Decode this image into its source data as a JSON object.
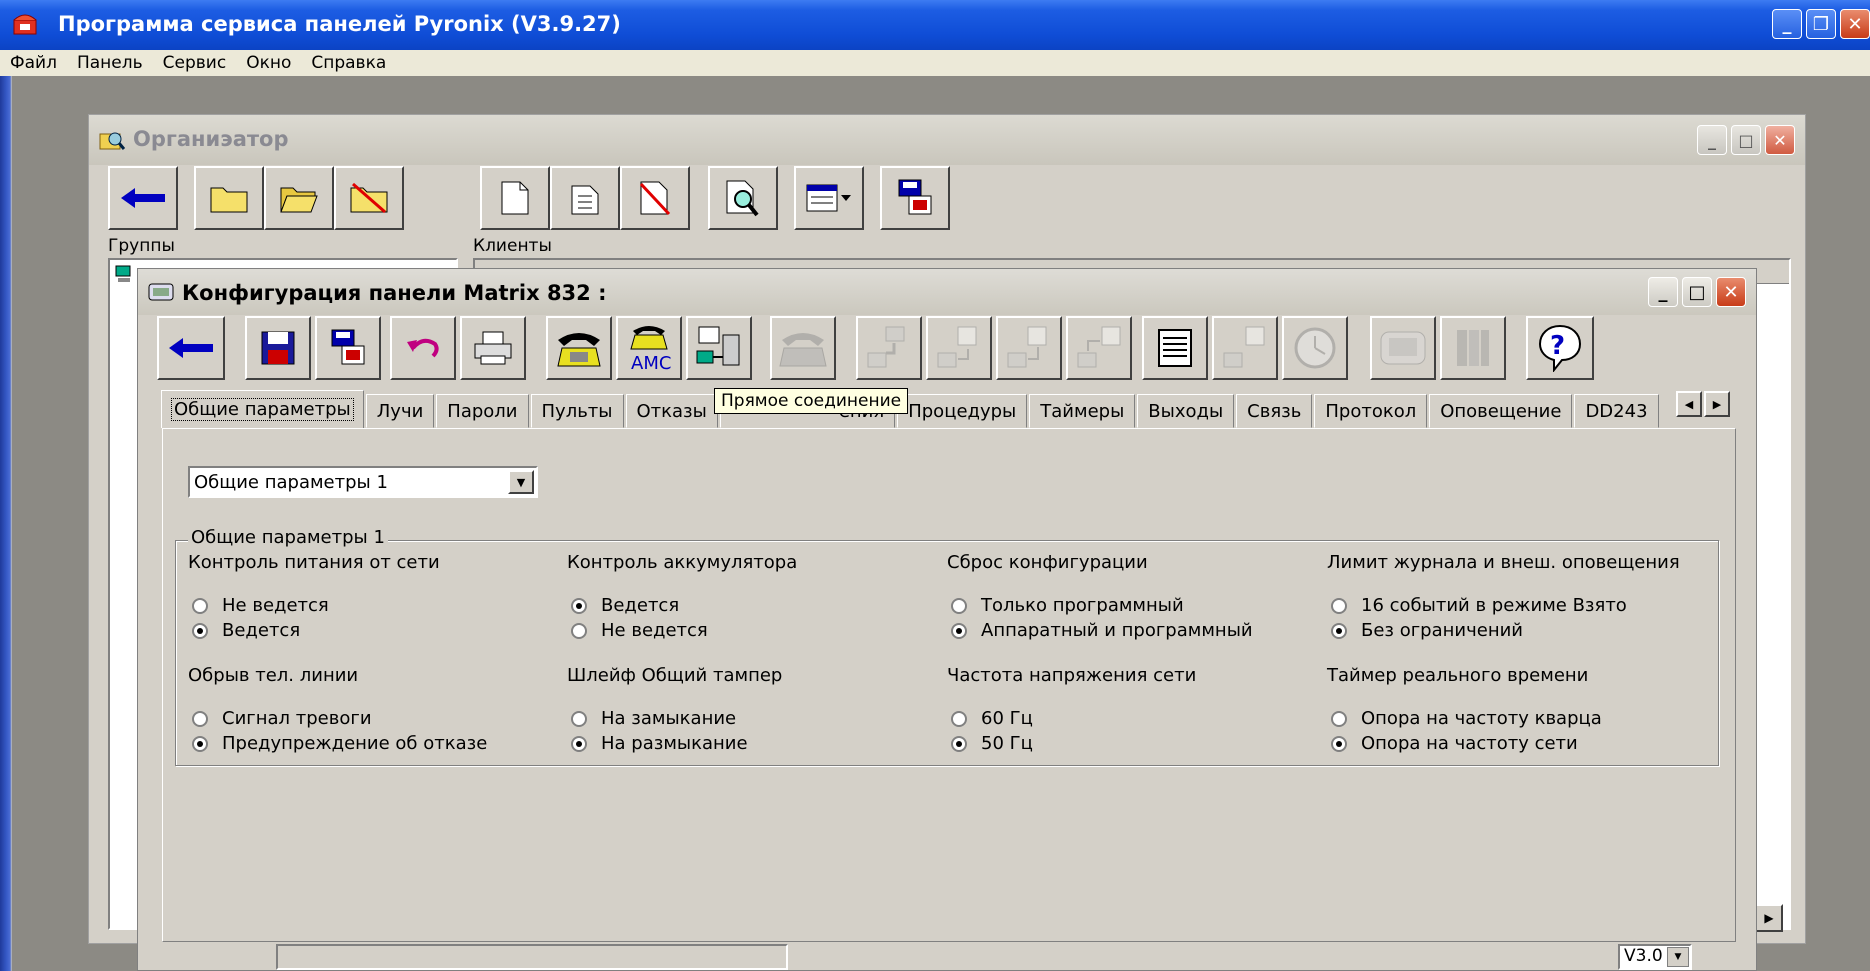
{
  "app": {
    "title": "Программа сервиса панелей Pyronix (V3.9.27)",
    "menu": [
      "Файл",
      "Панель",
      "Сервис",
      "Окно",
      "Справка"
    ]
  },
  "organizer": {
    "title": "Органиэатор",
    "groups_label": "Группы",
    "clients_label": "Клиенты"
  },
  "config": {
    "title": "Конфигурация панели Matrix 832 :",
    "tooltip": "Прямое соединение",
    "tabs": [
      {
        "label": "Общие параметры",
        "active": true
      },
      {
        "label": "Лучи"
      },
      {
        "label": "Пароли"
      },
      {
        "label": "Пульты"
      },
      {
        "label": "Отказы"
      },
      {
        "label": "ения"
      },
      {
        "label": "Процедуры"
      },
      {
        "label": "Таймеры"
      },
      {
        "label": "Выходы"
      },
      {
        "label": "Связь"
      },
      {
        "label": "Протокол"
      },
      {
        "label": "Оповещение"
      },
      {
        "label": "DD243"
      }
    ],
    "select_value": "Общие параметры 1",
    "group_title": "Общие параметры 1",
    "params": [
      {
        "label": "Контроль питания от сети",
        "options": [
          {
            "text": "Не ведется",
            "checked": false
          },
          {
            "text": "Ведется",
            "checked": true
          }
        ]
      },
      {
        "label": "Контроль аккумулятора",
        "options": [
          {
            "text": "Ведется",
            "checked": true
          },
          {
            "text": "Не ведется",
            "checked": false
          }
        ]
      },
      {
        "label": "Сброс конфигурации",
        "options": [
          {
            "text": "Только программный",
            "checked": false
          },
          {
            "text": "Аппаратный и программный",
            "checked": true
          }
        ]
      },
      {
        "label": "Лимит журнала и внеш. оповещения",
        "options": [
          {
            "text": "16 событий в режиме Взято",
            "checked": false
          },
          {
            "text": "Без ограничений",
            "checked": true
          }
        ]
      },
      {
        "label": "Обрыв тел. линии",
        "options": [
          {
            "text": "Сигнал тревоги",
            "checked": false
          },
          {
            "text": "Предупреждение об отказе",
            "checked": true
          }
        ]
      },
      {
        "label": "Шлейф Общий тампер",
        "options": [
          {
            "text": "На замыкание",
            "checked": false
          },
          {
            "text": "На размыкание",
            "checked": true
          }
        ]
      },
      {
        "label": "Частота напряжения сети",
        "options": [
          {
            "text": "60 Гц",
            "checked": false
          },
          {
            "text": "50 Гц",
            "checked": true
          }
        ]
      },
      {
        "label": "Таймер реального времени",
        "options": [
          {
            "text": "Опора на частоту кварца",
            "checked": false
          },
          {
            "text": "Опора на частоту сети",
            "checked": true
          }
        ]
      }
    ],
    "version": "V3.0",
    "amc_label": "AMC"
  },
  "colors": {
    "titlebar": "#0f4dd6",
    "face": "#d4d0c8",
    "tooltip": "#ffffe1"
  }
}
